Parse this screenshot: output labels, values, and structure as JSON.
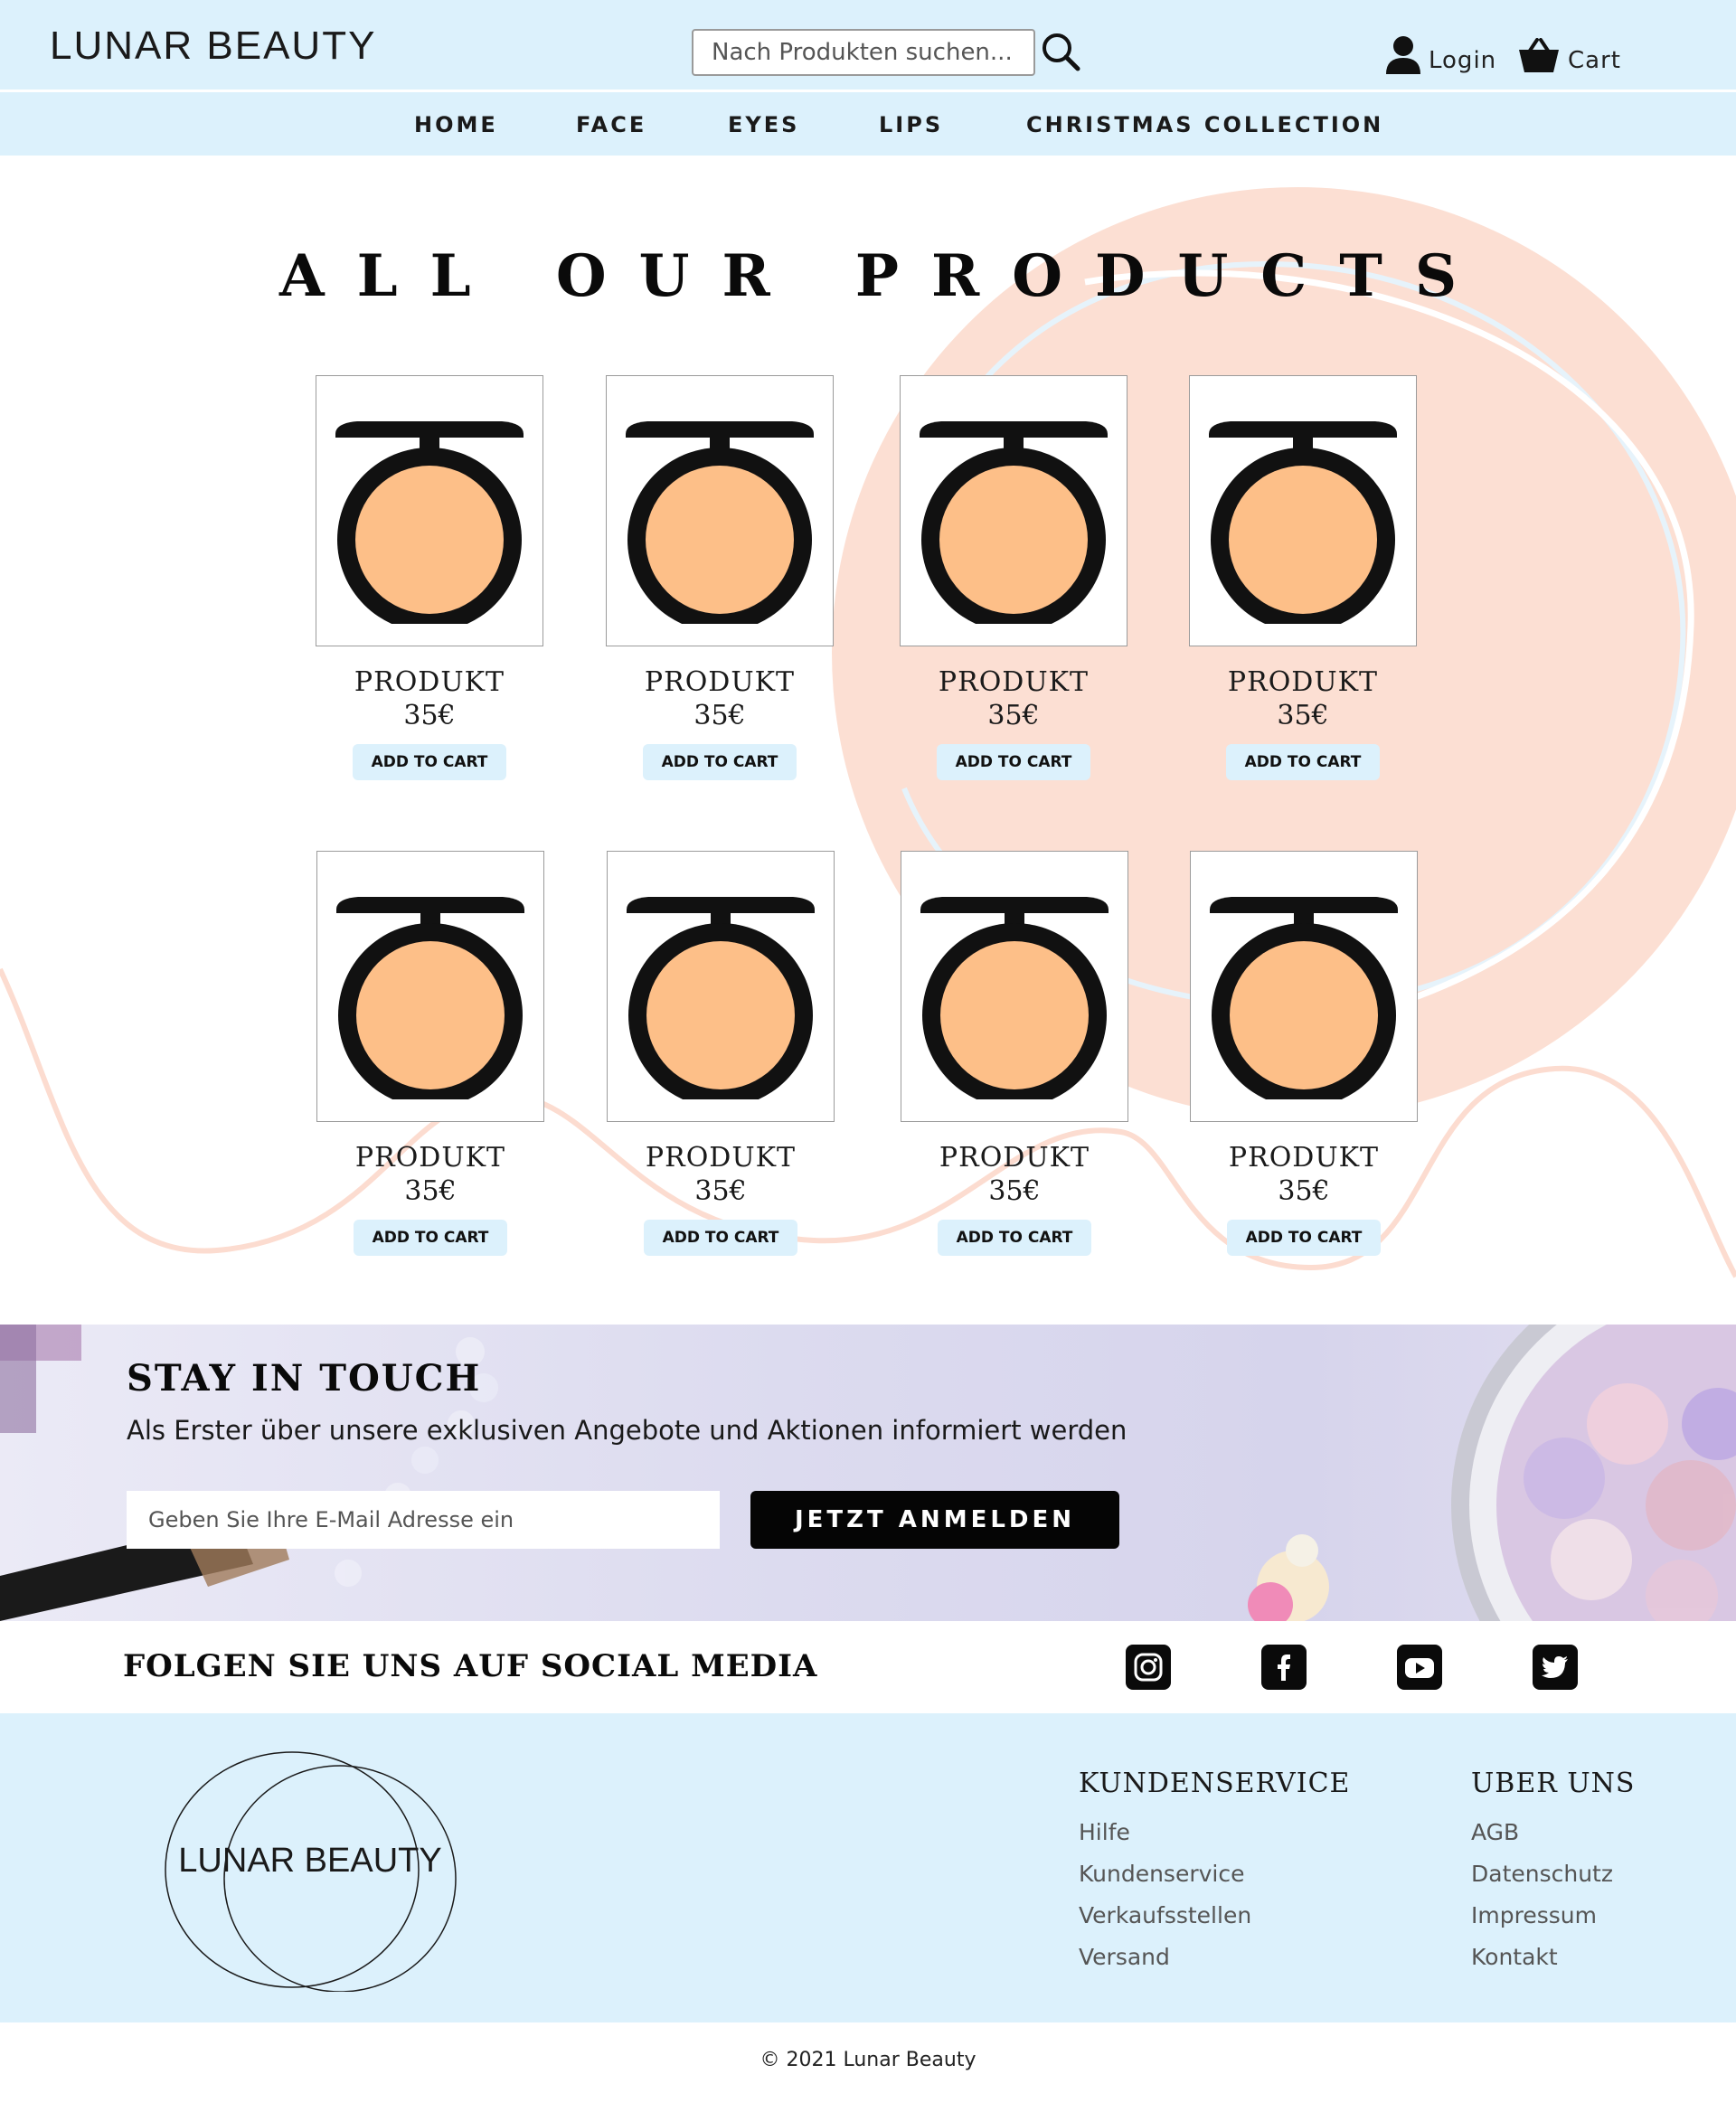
{
  "header": {
    "brand": "LUNAR BEAUTY",
    "search_placeholder": "Nach Produkten suchen...",
    "login_label": "Login",
    "cart_label": "Cart"
  },
  "nav": {
    "items": [
      "HOME",
      "FACE",
      "EYES",
      "LIPS",
      "CHRISTMAS COLLECTION"
    ]
  },
  "main": {
    "title": "ALL OUR PRODUCTS",
    "products": [
      {
        "name": "PRODUKT",
        "price": "35€",
        "button": "ADD TO CART"
      },
      {
        "name": "PRODUKT",
        "price": "35€",
        "button": "ADD TO CART"
      },
      {
        "name": "PRODUKT",
        "price": "35€",
        "button": "ADD TO CART"
      },
      {
        "name": "PRODUKT",
        "price": "35€",
        "button": "ADD TO CART"
      },
      {
        "name": "PRODUKT",
        "price": "35€",
        "button": "ADD TO CART"
      },
      {
        "name": "PRODUKT",
        "price": "35€",
        "button": "ADD TO CART"
      },
      {
        "name": "PRODUKT",
        "price": "35€",
        "button": "ADD TO CART"
      },
      {
        "name": "PRODUKT",
        "price": "35€",
        "button": "ADD TO CART"
      }
    ]
  },
  "newsletter": {
    "title": "STAY IN TOUCH",
    "subtitle": "Als Erster über unsere exklusiven Angebote und Aktionen informiert werden",
    "email_placeholder": "Geben Sie Ihre E-Mail Adresse ein",
    "button": "JETZT ANMELDEN"
  },
  "social": {
    "title": "FOLGEN SIE UNS AUF SOCIAL MEDIA",
    "icons": [
      "instagram-icon",
      "facebook-icon",
      "youtube-icon",
      "twitter-icon"
    ]
  },
  "footer": {
    "logo_text": "LUNAR BEAUTY",
    "columns": [
      {
        "heading": "KUNDENSERVICE",
        "links": [
          "Hilfe",
          "Kundenservice",
          "Verkaufsstellen",
          "Versand"
        ]
      },
      {
        "heading": "UBER UNS",
        "links": [
          "AGB",
          "Datenschutz",
          "Impressum",
          "Kontakt"
        ]
      }
    ],
    "copyright": "© 2021 Lunar Beauty"
  },
  "colors": {
    "header_bg": "#dcf1fc",
    "accent_peach": "#fcd9cc",
    "button_dark": "#050505",
    "newsletter_bg": "#dcdbef"
  }
}
